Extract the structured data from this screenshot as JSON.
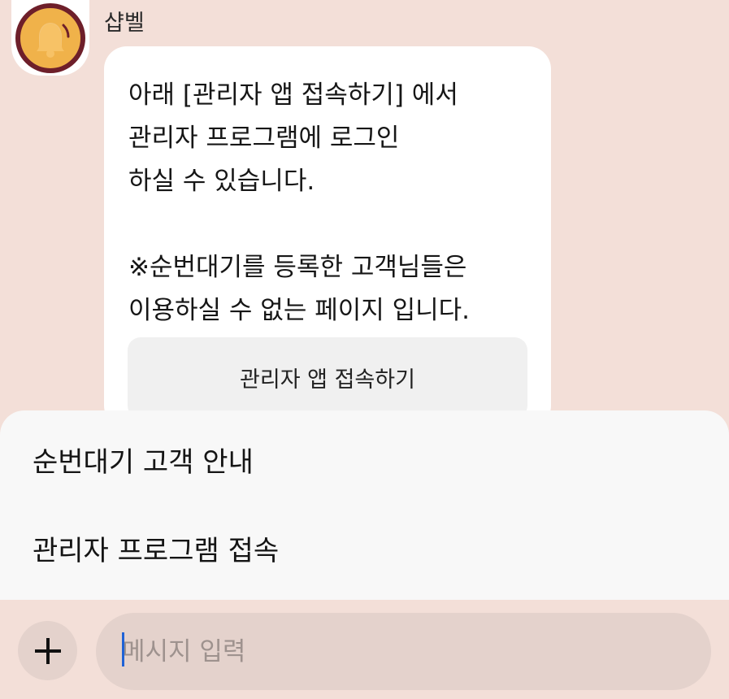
{
  "header": {
    "sender_name": "샵벨",
    "avatar_icon": "bell-icon"
  },
  "message": {
    "text": "아래 [관리자 앱 접속하기] 에서\n관리자 프로그램에 로그인\n하실 수 있습니다.\n\n※순번대기를 등록한 고객님들은\n이용하실 수 없는 페이지 입니다.",
    "button_label": "관리자 앱 접속하기"
  },
  "quick_replies": [
    {
      "label": "순번대기 고객 안내"
    },
    {
      "label": "관리자 프로그램 접속"
    }
  ],
  "composer": {
    "plus_icon": "plus-icon",
    "placeholder": "메시지 입력",
    "value": ""
  },
  "colors": {
    "background": "#f3dfd8",
    "bell": "#f0b24a",
    "ring": "#6e1f2a",
    "input_bg": "#e4d2cc",
    "caret": "#1f62d6"
  }
}
